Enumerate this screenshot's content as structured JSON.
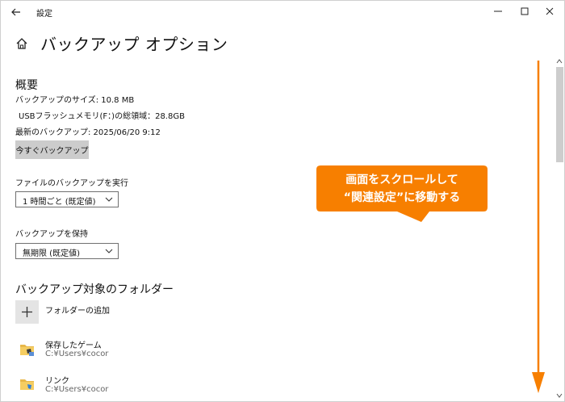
{
  "window": {
    "title": "設定",
    "page_title": "バックアップ オプション"
  },
  "overview": {
    "heading": "概要",
    "backup_size": "バックアップのサイズ: 10.8 MB",
    "total_space": "USBフラッシュメモリ(F：)の総領域：28.8GB",
    "last_backup": "最新のバックアップ: 2025/06/20 9:12",
    "backup_now_label": "今すぐバックアップ"
  },
  "run_backup": {
    "label": "ファイルのバックアップを実行",
    "value": "1 時間ごと (既定値)"
  },
  "keep_backup": {
    "label": "バックアップを保持",
    "value": "無期限 (既定値)"
  },
  "folders": {
    "heading": "バックアップ対象のフォルダー",
    "add_label": "フォルダーの追加",
    "items": [
      {
        "name": "保存したゲーム",
        "path": "C:¥Users¥cocor"
      },
      {
        "name": "リンク",
        "path": "C:¥Users¥cocor"
      }
    ]
  },
  "annotation": {
    "line1": "画面をスクロールして",
    "line2": "“関連設定”に移動する",
    "color": "#f77f00"
  },
  "icons": {
    "back": "back-arrow-icon",
    "home": "home-icon",
    "add": "plus-icon",
    "folder": "folder-icon"
  }
}
